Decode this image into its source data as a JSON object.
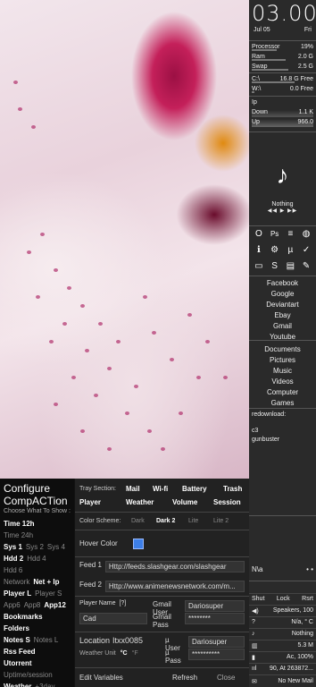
{
  "clock": {
    "time": "03.00",
    "date": "Jul 05",
    "day": "Fri"
  },
  "stats": [
    {
      "label": "Processor",
      "value": "19%",
      "fill": 0.19
    },
    {
      "label": "Ram",
      "value": "2.0 G",
      "fill": 0.5
    },
    {
      "label": "Swap",
      "value": "2.5 G",
      "fill": 0.6
    }
  ],
  "drives": [
    {
      "label": "C:\\",
      "value": "16.8 G Free",
      "fill": 0.7
    },
    {
      "label": "W:\\",
      "value": "0.0 Free",
      "fill": 0.05
    }
  ],
  "net": {
    "title": "Ip",
    "down_label": "Down",
    "down": "1.1 K",
    "up_label": "Up",
    "up": "966.0"
  },
  "player": {
    "status": "Nothing",
    "controls": "◀◀  ▶  ▶▶",
    "note_icon": "music-note-icon"
  },
  "links": [
    "Facebook",
    "Google",
    "Deviantart",
    "Ebay",
    "Gmail",
    "Youtube"
  ],
  "folders": [
    "Documents",
    "Pictures",
    "Music",
    "Videos",
    "Computer",
    "Games"
  ],
  "feed": {
    "title": "redownload:",
    "items": [
      "c3",
      "gunbuster"
    ]
  },
  "notes": "N\\a",
  "bottom": {
    "power": [
      "Shut",
      "Lock",
      "Rsrt"
    ],
    "speakers": "Speakers, 100",
    "weather": "N/a, ° C",
    "nothing": "Nothing",
    "mem": "5.3 M",
    "battery": "Ac, 100%",
    "wifi": "90, At 263872...",
    "mail": "No New Mail"
  },
  "config": {
    "title": "Configure CompACTion",
    "subtitle": "Choose What To Show :",
    "options": [
      [
        "Time 12h",
        "Time 24h"
      ],
      [
        "Sys 1",
        "Sys 2",
        "Sys 4"
      ],
      [
        "Hdd 2",
        "Hdd 4",
        "Hdd 6"
      ],
      [
        "Network",
        "Net + Ip"
      ],
      [
        "Player L",
        "Player S"
      ],
      [
        "App6",
        "App8",
        "App12"
      ],
      [
        "Bookmarks"
      ],
      [
        "Folders"
      ],
      [
        "Notes S",
        "Notes L"
      ],
      [
        "Rss Feed"
      ],
      [
        "Utorrent"
      ],
      [
        "Uptime/session"
      ],
      [
        "Weather",
        "+3day"
      ]
    ],
    "tray_label": "Tray Section:",
    "tray": [
      "Mail",
      "Wi-fi",
      "Battery",
      "Trash",
      "Player",
      "Weather",
      "Volume",
      "Session"
    ],
    "scheme_label": "Color Scheme:",
    "schemes": [
      "Dark",
      "Dark 2",
      "Lite",
      "Lite 2"
    ],
    "hover_label": "Hover Color",
    "hover_color": "#3d7fe8",
    "feed1_label": "Feed 1",
    "feed1": "Http://feeds.slashgear.com/slashgear",
    "feed2_label": "Feed 2",
    "feed2": "Http://www.animenewsnetwork.com/m...",
    "player_label": "Player Name",
    "player_help": "[?]",
    "player_value": "Cad",
    "gmail_user_label": "Gmail User",
    "gmail_user": "Dariosuper",
    "gmail_pass_label": "Gmail Pass",
    "gmail_pass": "********",
    "location_label": "Location",
    "location": "Itxx0085",
    "mu_user_label": "µ User",
    "mu_user": "Dariosuper",
    "mu_pass_label": "µ Pass",
    "mu_pass": "**********",
    "unit_label": "Weather Unit",
    "unit_c": "°C",
    "unit_f": "°F",
    "edit": "Edit Variables",
    "refresh": "Refresh",
    "close": "Close"
  }
}
